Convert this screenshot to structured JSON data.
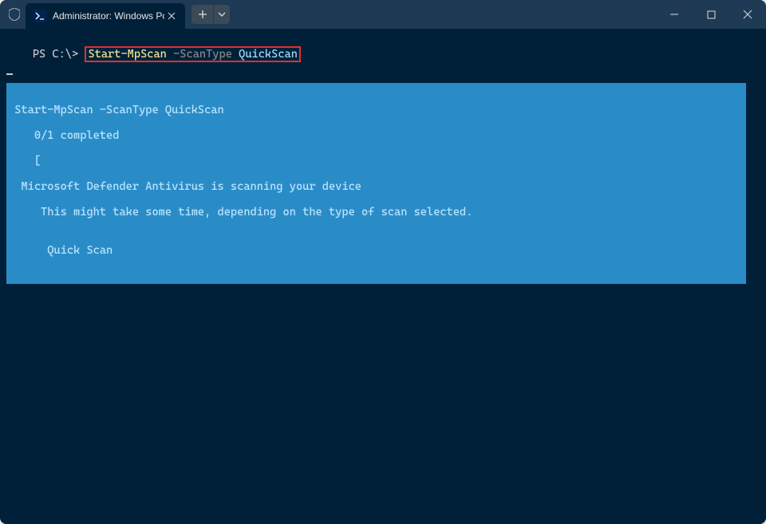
{
  "titlebar": {
    "tab_title": "Administrator: Windows Powe",
    "shield_tooltip": "Elevated"
  },
  "prompt": {
    "prefix": "PS C:\\> ",
    "cmd_base": "Start-MpScan",
    "cmd_param": " -ScanType ",
    "cmd_value": "QuickScan"
  },
  "progress": {
    "l1": " Start-MpScan -ScanType QuickScan",
    "l2": "    0/1 completed",
    "l3_open": "    [",
    "l3_close": "]",
    "l3_gap_chars": 118,
    "l4": "  Microsoft Defender Antivirus is scanning your device",
    "l5": "     This might take some time, depending on the type of scan selected.",
    "l6": "",
    "l7": "      Quick Scan"
  },
  "colors": {
    "bg": "#00203a",
    "titlebar": "#1e3a54",
    "progress_bg": "#2a8cc7",
    "highlight_border": "#e03030",
    "cmd_yellow": "#f0e68c",
    "cmd_grey": "#888888",
    "cmd_blue": "#9cdcfe"
  }
}
